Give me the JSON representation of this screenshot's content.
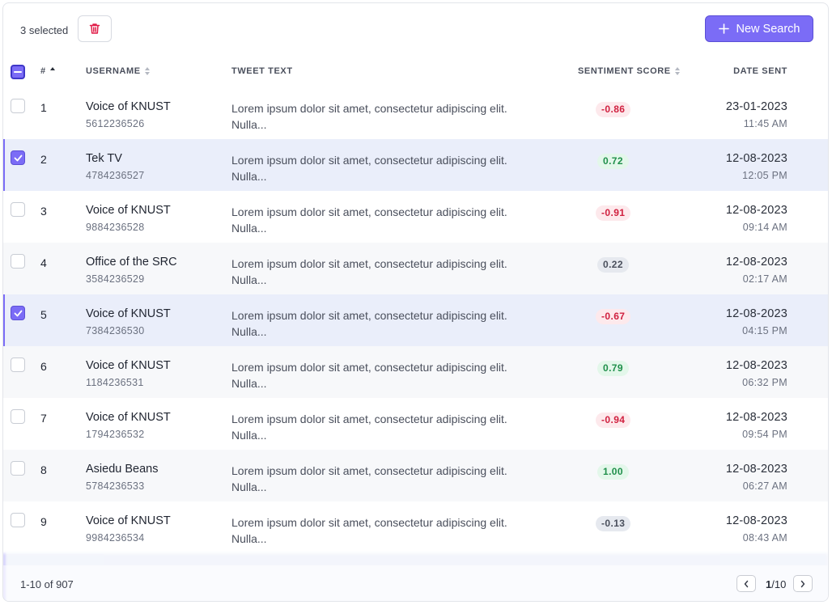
{
  "toolbar": {
    "selected_label": "3 selected",
    "new_search_label": "New Search",
    "accent_color": "#7b6cf6",
    "delete_color": "#e11d48"
  },
  "columns": {
    "num": "#",
    "username": "USERNAME",
    "tweet_text": "TWEET TEXT",
    "sentiment": "SENTIMENT SCORE",
    "date": "DATE SENT"
  },
  "rows": [
    {
      "num": "1",
      "name": "Voice of KNUST",
      "id": "5612236526",
      "text": "Lorem ipsum dolor sit amet, consectetur adipiscing elit. Nulla...",
      "score": "-0.86",
      "tone": "neg",
      "date": "23-01-2023",
      "time": "11:45 AM",
      "checked": false
    },
    {
      "num": "2",
      "name": "Tek TV",
      "id": "4784236527",
      "text": "Lorem ipsum dolor sit amet, consectetur adipiscing elit. Nulla...",
      "score": "0.72",
      "tone": "pos",
      "date": "12-08-2023",
      "time": "12:05 PM",
      "checked": true
    },
    {
      "num": "3",
      "name": "Voice of KNUST",
      "id": "9884236528",
      "text": "Lorem ipsum dolor sit amet, consectetur adipiscing elit. Nulla...",
      "score": "-0.91",
      "tone": "neg",
      "date": "12-08-2023",
      "time": "09:14 AM",
      "checked": false
    },
    {
      "num": "4",
      "name": "Office of the SRC",
      "id": "3584236529",
      "text": "Lorem ipsum dolor sit amet, consectetur adipiscing elit. Nulla...",
      "score": "0.22",
      "tone": "neu",
      "date": "12-08-2023",
      "time": "02:17 AM",
      "checked": false
    },
    {
      "num": "5",
      "name": "Voice of KNUST",
      "id": "7384236530",
      "text": "Lorem ipsum dolor sit amet, consectetur adipiscing elit. Nulla...",
      "score": "-0.67",
      "tone": "neg",
      "date": "12-08-2023",
      "time": "04:15 PM",
      "checked": true
    },
    {
      "num": "6",
      "name": "Voice of KNUST",
      "id": "1184236531",
      "text": "Lorem ipsum dolor sit amet, consectetur adipiscing elit. Nulla...",
      "score": "0.79",
      "tone": "pos",
      "date": "12-08-2023",
      "time": "06:32 PM",
      "checked": false
    },
    {
      "num": "7",
      "name": "Voice of KNUST",
      "id": "1794236532",
      "text": "Lorem ipsum dolor sit amet, consectetur adipiscing elit. Nulla...",
      "score": "-0.94",
      "tone": "neg",
      "date": "12-08-2023",
      "time": "09:54 PM",
      "checked": false
    },
    {
      "num": "8",
      "name": "Asiedu Beans",
      "id": "5784236533",
      "text": "Lorem ipsum dolor sit amet, consectetur adipiscing elit. Nulla...",
      "score": "1.00",
      "tone": "pos",
      "date": "12-08-2023",
      "time": "06:27 AM",
      "checked": false
    },
    {
      "num": "9",
      "name": "Voice of KNUST",
      "id": "9984236534",
      "text": "Lorem ipsum dolor sit amet, consectetur adipiscing elit. Nulla...",
      "score": "-0.13",
      "tone": "neu",
      "date": "12-08-2023",
      "time": "08:43 AM",
      "checked": false
    }
  ],
  "footer": {
    "range_label": "1-10 of 907",
    "page_current": "1",
    "page_total": "/10"
  }
}
